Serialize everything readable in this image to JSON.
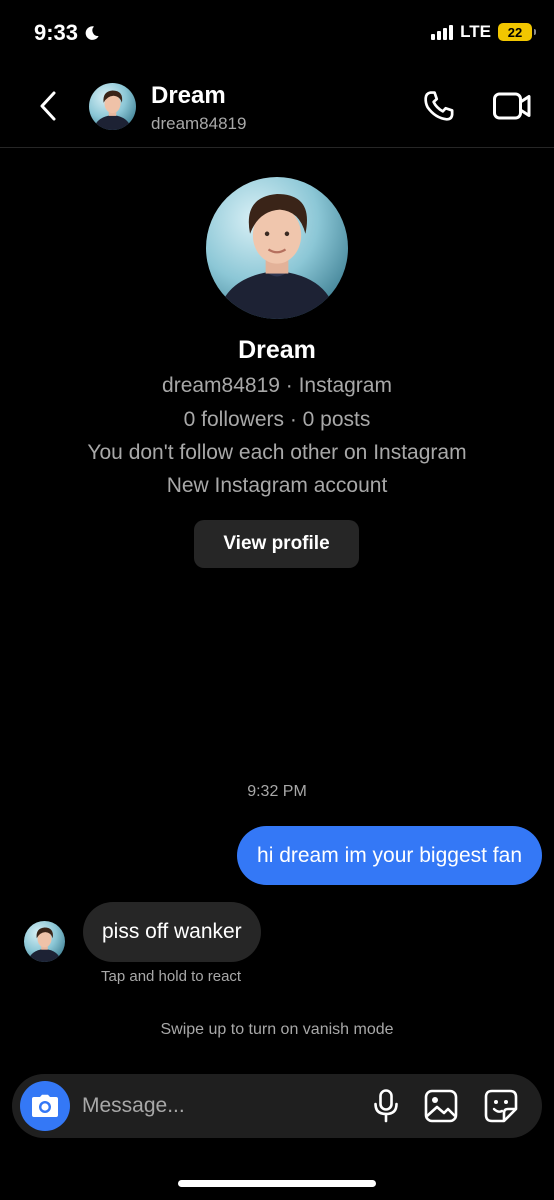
{
  "status_bar": {
    "time": "9:33",
    "network": "LTE",
    "battery": "22"
  },
  "header": {
    "name": "Dream",
    "handle": "dream84819"
  },
  "profile": {
    "name": "Dream",
    "handle_line": "dream84819 · Instagram",
    "stats_line": "0 followers · 0 posts",
    "follow_line": "You don't follow each other on Instagram",
    "account_line": "New Instagram account",
    "view_profile_label": "View profile"
  },
  "conversation": {
    "timestamp": "9:32 PM",
    "messages": [
      {
        "direction": "outgoing",
        "text": "hi dream im your biggest fan"
      },
      {
        "direction": "incoming",
        "text": "piss off wanker"
      }
    ],
    "react_hint": "Tap and hold to react",
    "vanish_hint": "Swipe up to turn on vanish mode"
  },
  "composer": {
    "placeholder": "Message..."
  },
  "icons": {
    "back": "chevron-left-icon",
    "call": "phone-icon",
    "video": "video-camera-icon",
    "camera": "camera-icon",
    "mic": "microphone-icon",
    "gallery": "image-icon",
    "sticker": "sticker-icon",
    "dnd": "moon-icon"
  },
  "colors": {
    "background": "#000000",
    "outgoing_bubble": "#3478f6",
    "incoming_bubble": "#262626",
    "secondary_text": "#a8a8a8",
    "battery": "#f2c600"
  }
}
